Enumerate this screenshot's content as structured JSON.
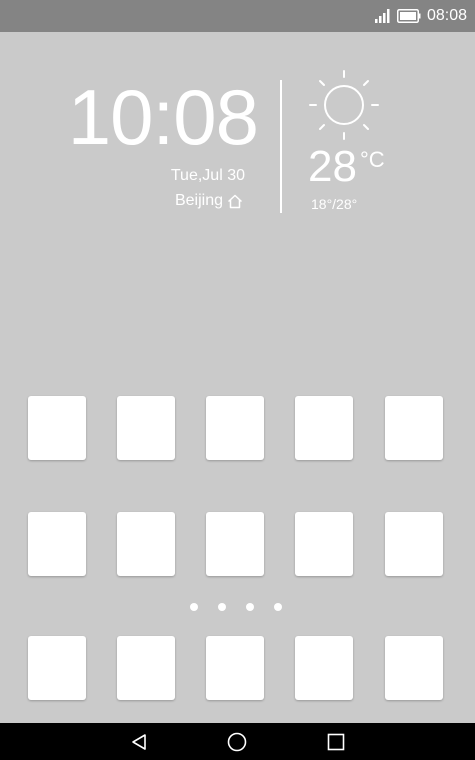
{
  "status_bar": {
    "time": "08:08",
    "signal_icon": "signal-icon",
    "battery_icon": "battery-icon"
  },
  "clock_widget": {
    "time": "10:08",
    "date": "Tue,Jul 30",
    "city": "Beijing",
    "home_icon": "home-icon"
  },
  "weather_widget": {
    "icon": "sun-icon",
    "temperature": "28",
    "unit": "°C",
    "range": "18°/28°"
  },
  "home_screen": {
    "app_rows": 3,
    "apps_per_row": 5,
    "page_indicator_count": 4
  },
  "nav_bar": {
    "back_icon": "back-icon",
    "home_icon": "home-circle-icon",
    "recents_icon": "recents-icon"
  },
  "colors": {
    "wallpaper": "#cacaca",
    "status_bar": "#848484",
    "nav_bar": "#000000",
    "foreground": "#ffffff"
  }
}
